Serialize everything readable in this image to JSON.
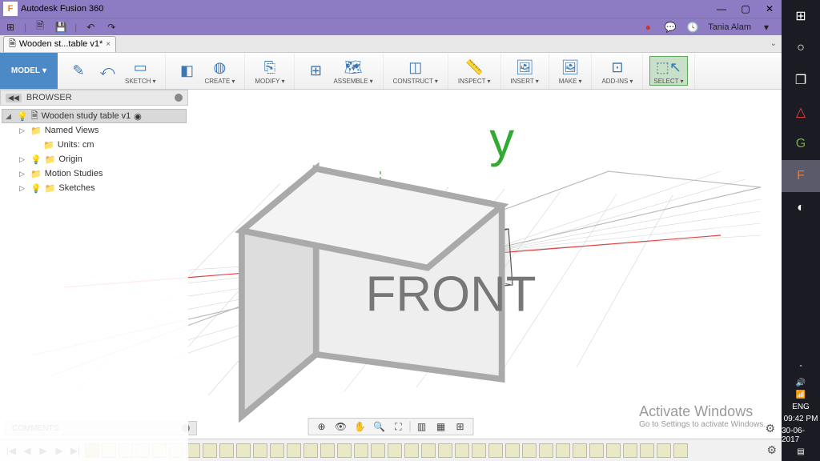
{
  "titlebar": {
    "app_letter": "F",
    "app_name": "Autodesk Fusion 360",
    "min": "—",
    "max": "▢",
    "close": "✕"
  },
  "qa": {
    "grid": "⊞",
    "new": "🗎",
    "save": "💾",
    "undo": "↶",
    "redo": "↷",
    "record": "●",
    "chat": "💬",
    "clock": "🕓",
    "user": "Tania Alam",
    "menu": "▾"
  },
  "doc_tab": {
    "icon": "🗎",
    "label": "Wooden st...table v1*",
    "close": "×",
    "expand": "⌄"
  },
  "toolbar": {
    "model": "MODEL",
    "groups": [
      {
        "label": "SKETCH",
        "items": [
          {
            "icon": "✎"
          },
          {
            "icon": "⤺"
          },
          {
            "icon": "▭"
          }
        ]
      },
      {
        "label": "CREATE",
        "items": [
          {
            "icon": "◧"
          },
          {
            "icon": "◍"
          }
        ]
      },
      {
        "label": "MODIFY",
        "items": [
          {
            "icon": "⎘"
          }
        ]
      },
      {
        "label": "ASSEMBLE",
        "items": [
          {
            "icon": "⊞"
          },
          {
            "icon": "🗺"
          }
        ]
      },
      {
        "label": "CONSTRUCT",
        "items": [
          {
            "icon": "◫"
          }
        ]
      },
      {
        "label": "INSPECT",
        "items": [
          {
            "icon": "📏"
          }
        ]
      },
      {
        "label": "INSERT",
        "items": [
          {
            "icon": "🖼"
          }
        ]
      },
      {
        "label": "MAKE",
        "items": [
          {
            "icon": "🖼"
          }
        ]
      },
      {
        "label": "ADD-INS",
        "items": [
          {
            "icon": "⊡"
          }
        ]
      },
      {
        "label": "SELECT",
        "items": [
          {
            "icon": "⬚↖"
          }
        ],
        "selected": true
      }
    ]
  },
  "browser": {
    "pin": "◀◀",
    "title": "BROWSER",
    "root": {
      "icon": "🗎",
      "label": "Wooden study table v1",
      "toggle": "◉"
    },
    "items": [
      {
        "label": "Named Views",
        "expandable": true,
        "bulb": false
      },
      {
        "label": "Units: cm",
        "expandable": false,
        "bulb": false,
        "indent": 2
      },
      {
        "label": "Origin",
        "expandable": true,
        "bulb": true
      },
      {
        "label": "Motion Studies",
        "expandable": true,
        "bulb": false
      },
      {
        "label": "Sketches",
        "expandable": true,
        "bulb": true
      }
    ]
  },
  "viewcube": {
    "face": "FRONT"
  },
  "comments": {
    "label": "COMMENTS"
  },
  "nav": {
    "orbit": "⊕",
    "look": "👁",
    "pan": "✋",
    "zoom": "🔍",
    "fit": "⛶",
    "display": "▥",
    "grid": "▦",
    "viewports": "⊞"
  },
  "watermark": {
    "l1": "Activate Windows",
    "l2": "Go to Settings to activate Windows."
  },
  "timeline": {
    "start": "|◀",
    "prev": "◀",
    "play": "▶",
    "next": "▶",
    "end": "▶|",
    "frame_count": 36
  },
  "win_sidebar": {
    "icons": [
      "⊞",
      "○",
      "❐",
      "△",
      "G",
      "F",
      "◐"
    ],
    "sys": {
      "up": "＾",
      "vol": "🔊",
      "net": "📶",
      "lang": "ENG",
      "time": "09:42 PM",
      "date": "30-06-2017",
      "notif": "▤"
    }
  },
  "gear": "⚙"
}
